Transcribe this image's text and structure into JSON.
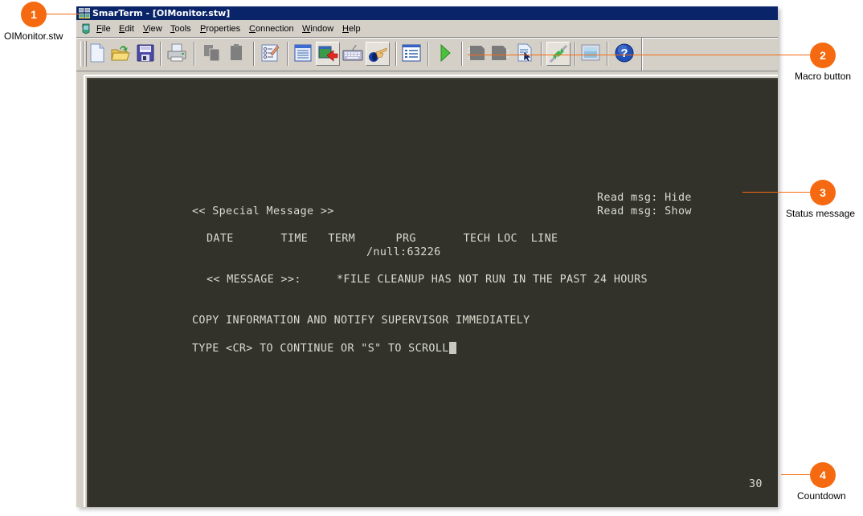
{
  "window": {
    "title": "SmarTerm - [OIMonitor.stw]",
    "title_bar_color": "#0a246a"
  },
  "menu": {
    "items": [
      {
        "label": "File",
        "mnemonic": "F",
        "rest": "ile"
      },
      {
        "label": "Edit",
        "mnemonic": "E",
        "rest": "dit"
      },
      {
        "label": "View",
        "mnemonic": "V",
        "rest": "iew"
      },
      {
        "label": "Tools",
        "mnemonic": "T",
        "rest": "ools"
      },
      {
        "label": "Properties",
        "mnemonic": "P",
        "rest": "roperties"
      },
      {
        "label": "Connection",
        "mnemonic": "C",
        "rest": "onnection"
      },
      {
        "label": "Window",
        "mnemonic": "W",
        "rest": "indow"
      },
      {
        "label": "Help",
        "mnemonic": "H",
        "rest": "elp"
      }
    ]
  },
  "toolbar": {
    "buttons": [
      {
        "name": "new-file",
        "icon": "new-document-icon"
      },
      {
        "name": "open-file",
        "icon": "open-folder-icon"
      },
      {
        "name": "save-file",
        "icon": "floppy-disk-icon"
      },
      {
        "name": "print",
        "icon": "printer-icon"
      },
      {
        "name": "copy",
        "icon": "copy-icon",
        "disabled": true
      },
      {
        "name": "paste",
        "icon": "paste-icon",
        "disabled": true
      },
      {
        "name": "properties",
        "icon": "checklist-icon"
      },
      {
        "name": "session-list",
        "icon": "list-icon"
      },
      {
        "name": "transfer",
        "icon": "transfer-icon",
        "pressed": true
      },
      {
        "name": "keyboard",
        "icon": "keyboard-icon"
      },
      {
        "name": "hotspots",
        "icon": "hand-pointer-icon",
        "pressed": true
      },
      {
        "name": "panel",
        "icon": "panel-icon"
      },
      {
        "name": "run-macro",
        "icon": "play-icon"
      },
      {
        "name": "record-macro-1",
        "icon": "chip-icon",
        "disabled": true
      },
      {
        "name": "record-macro-2",
        "icon": "chip-icon",
        "disabled": true
      },
      {
        "name": "select",
        "icon": "cursor-document-icon"
      },
      {
        "name": "connect",
        "icon": "plug-connect-icon",
        "pressed": true
      },
      {
        "name": "display",
        "icon": "screen-icon"
      },
      {
        "name": "help",
        "icon": "help-icon"
      }
    ]
  },
  "terminal": {
    "background": "#32322a",
    "foreground": "#d9dccf",
    "status_hide": "Read msg: Hide",
    "status_show": "Read msg: Show",
    "special_message": "<< Special Message >>",
    "headers": "DATE       TIME   TERM      PRG       TECH LOC  LINE",
    "prg_value": "/null:63226",
    "message_label": "<< MESSAGE >>:",
    "message_text": "*FILE CLEANUP HAS NOT RUN IN THE PAST 24 HOURS",
    "instruction": "COPY INFORMATION AND NOTIFY SUPERVISOR IMMEDIATELY",
    "prompt": "TYPE <CR> TO CONTINUE OR \"S\" TO SCROLL",
    "countdown": "30"
  },
  "callouts": [
    {
      "number": "1",
      "label": "OIMonitor.stw"
    },
    {
      "number": "2",
      "label": "Macro button"
    },
    {
      "number": "3",
      "label": "Status message"
    },
    {
      "number": "4",
      "label": "Countdown"
    }
  ],
  "callout_color": "#f56a10"
}
